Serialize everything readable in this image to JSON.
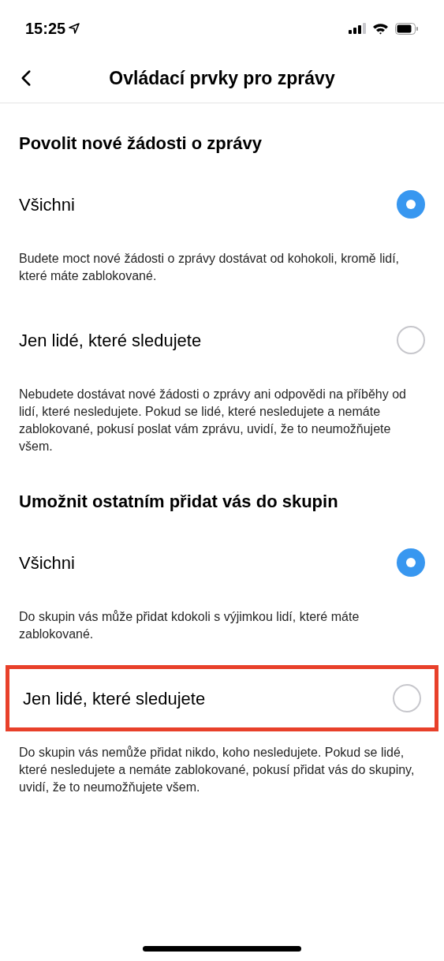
{
  "status_bar": {
    "time": "15:25"
  },
  "header": {
    "title": "Ovládací prvky pro zprávy"
  },
  "sections": [
    {
      "title": "Povolit nové žádosti o zprávy",
      "options": [
        {
          "label": "Všichni",
          "selected": true,
          "highlighted": false,
          "description": "Budete moct nové žádosti o zprávy dostávat od kohokoli, kromě lidí, které máte zablokované."
        },
        {
          "label": "Jen lidé, které sledujete",
          "selected": false,
          "highlighted": false,
          "description": "Nebudete dostávat nové žádosti o zprávy ani odpovědi na příběhy od lidí, které nesledujete. Pokud se lidé, které nesledujete a nemáte zablokované, pokusí poslat vám zprávu, uvidí, že to neumožňujete všem."
        }
      ]
    },
    {
      "title": "Umožnit ostatním přidat vás do skupin",
      "options": [
        {
          "label": "Všichni",
          "selected": true,
          "highlighted": false,
          "description": "Do skupin vás může přidat kdokoli s výjimkou lidí, které máte zablokované."
        },
        {
          "label": "Jen lidé, které sledujete",
          "selected": false,
          "highlighted": true,
          "description": "Do skupin vás nemůže přidat nikdo, koho nesledujete. Pokud se lidé, které nesledujete a nemáte zablokované, pokusí přidat vás do skupiny, uvidí, že to neumožňujete všem."
        }
      ]
    }
  ]
}
